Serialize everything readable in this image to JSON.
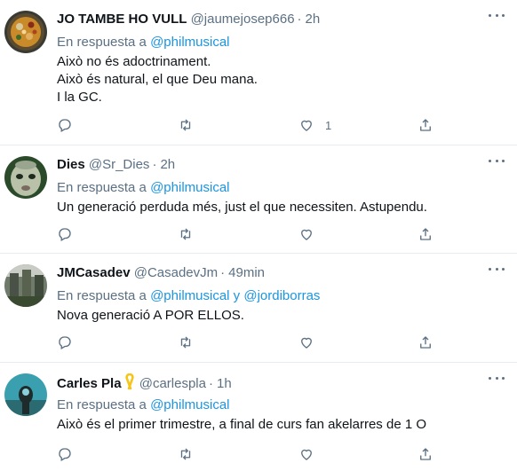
{
  "tweets": [
    {
      "name": "JO TAMBE HO VULL",
      "handle": "@jaumejosep666",
      "time": "2h",
      "reply_prefix": "En respuesta a",
      "reply_to_1": "@philmusical",
      "reply_joiner": "",
      "reply_to_2": "",
      "lines": [
        "Això no és adoctrinament.",
        "Això és natural, el que Deu mana.",
        "I la GC."
      ],
      "reply_count": "",
      "retweet_count": "",
      "like_count": "1",
      "avatar_icon": "paella-avatar-icon"
    },
    {
      "name": "Dies",
      "handle": "@Sr_Dies",
      "time": "2h",
      "reply_prefix": "En respuesta a",
      "reply_to_1": "@philmusical",
      "reply_joiner": "",
      "reply_to_2": "",
      "lines": [
        "Un generació perduda més, just el que necessiten. Astupendu."
      ],
      "reply_count": "",
      "retweet_count": "",
      "like_count": "",
      "avatar_icon": "baby-face-avatar-icon"
    },
    {
      "name": "JMCasadev",
      "handle": "@CasadevJm",
      "time": "49min",
      "reply_prefix": "En respuesta a",
      "reply_to_1": "@philmusical",
      "reply_joiner": " y ",
      "reply_to_2": "@jordiborras",
      "lines": [
        "Nova generació A POR ELLOS."
      ],
      "reply_count": "",
      "retweet_count": "",
      "like_count": "",
      "avatar_icon": "building-avatar-icon"
    },
    {
      "name": "Carles Pla",
      "handle": "@carlespla",
      "time": "1h",
      "reply_prefix": "En respuesta a",
      "reply_to_1": "@philmusical",
      "reply_joiner": "",
      "reply_to_2": "",
      "lines": [
        "Això és el primer trimestre, a final de curs fan akelarres de 1 O"
      ],
      "reply_count": "",
      "retweet_count": "",
      "like_count": "",
      "avatar_icon": "diver-avatar-icon"
    }
  ],
  "time_separator": "·",
  "colors": {
    "link": "#1b95e0",
    "secondary_text": "#5b7083",
    "divider": "#e6ecf0",
    "yellow_ribbon": "#f5c518"
  }
}
